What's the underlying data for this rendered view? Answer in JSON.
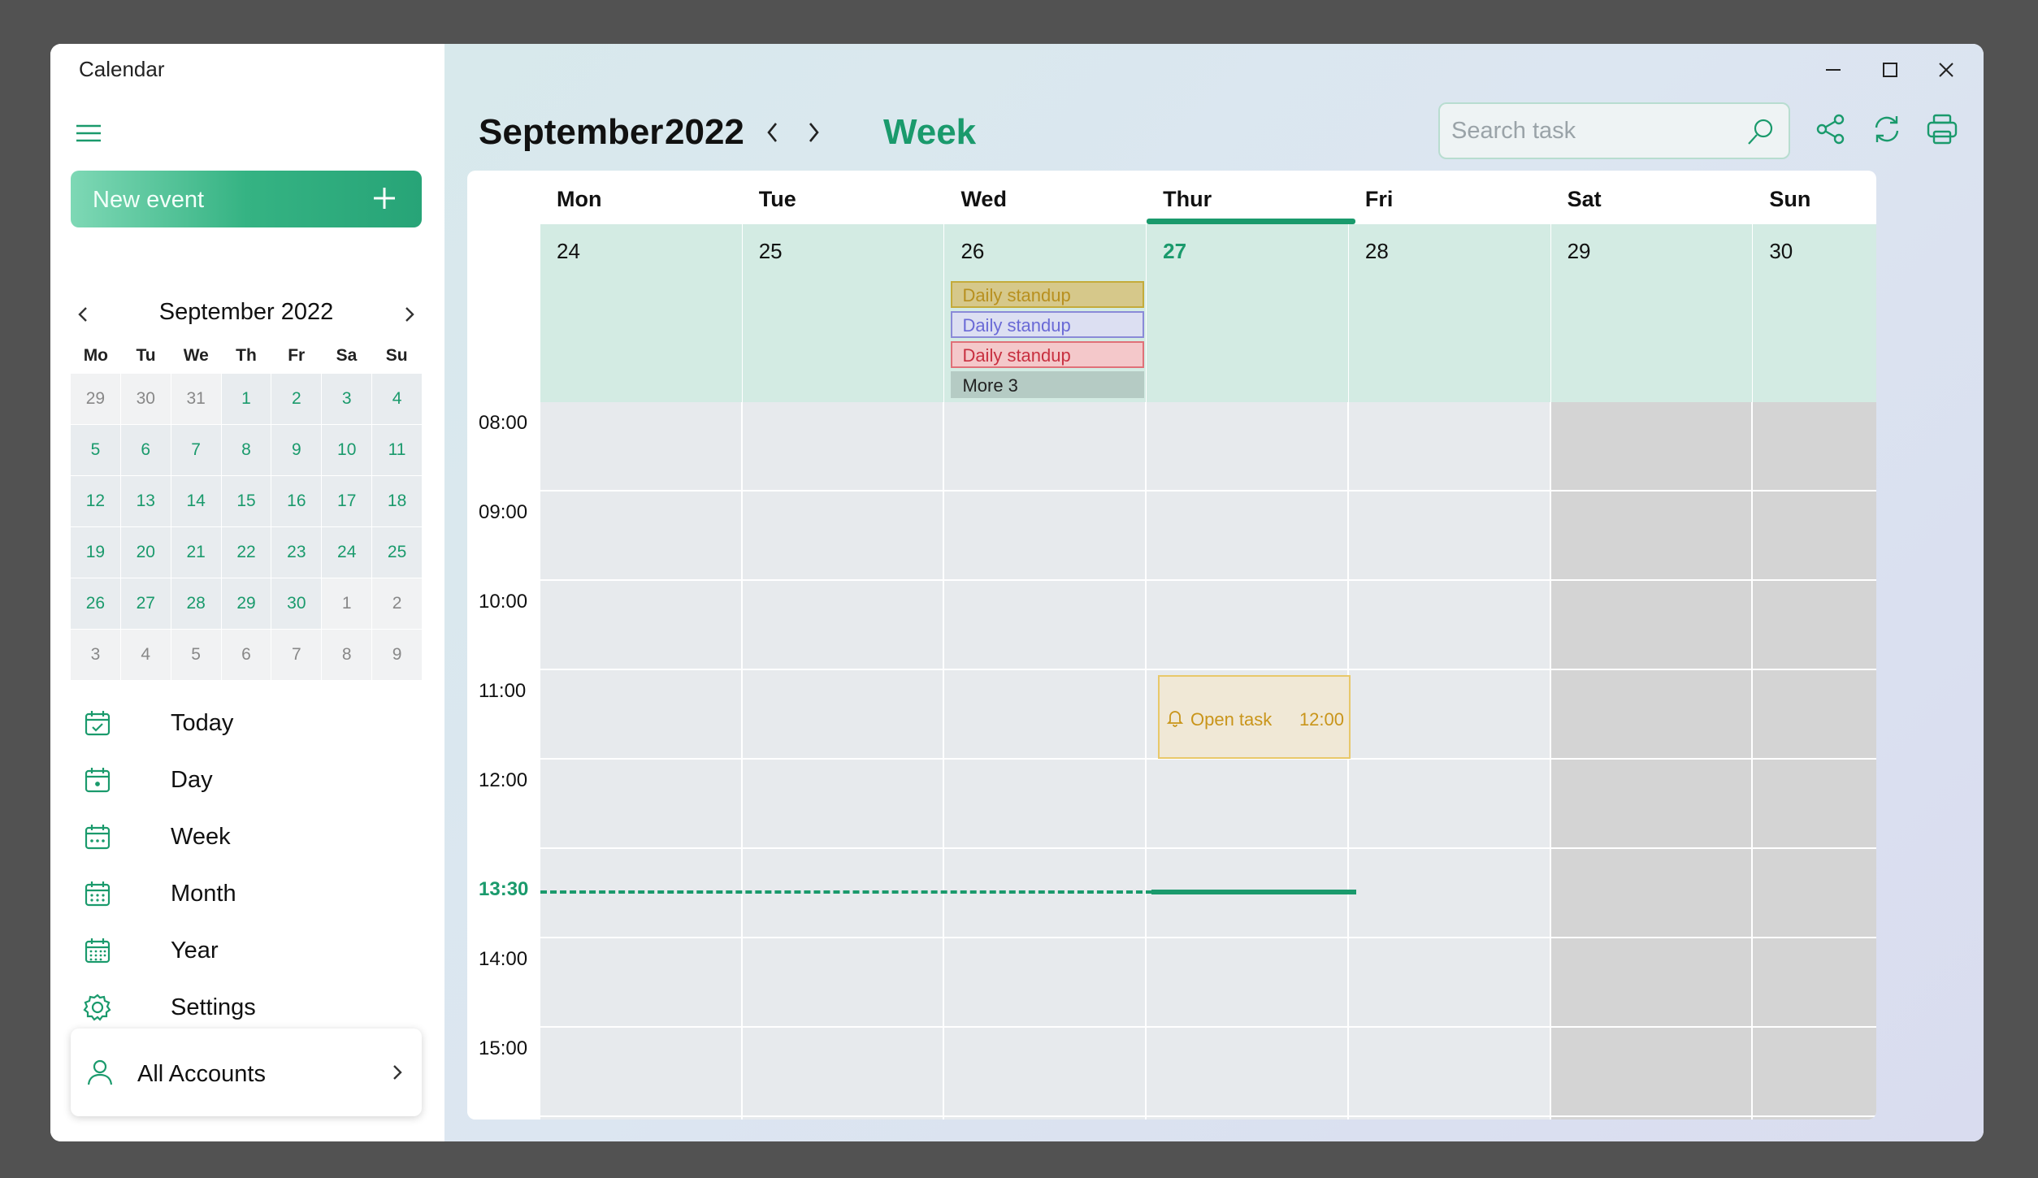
{
  "app": {
    "title": "Calendar"
  },
  "sidebar": {
    "new_event_label": "New event",
    "mini_calendar": {
      "title": "September 2022",
      "weekdays": [
        "Mo",
        "Tu",
        "We",
        "Th",
        "Fr",
        "Sa",
        "Su"
      ],
      "weeks": [
        [
          "29",
          "30",
          "31",
          "1",
          "2",
          "3",
          "4"
        ],
        [
          "5",
          "6",
          "7",
          "8",
          "9",
          "10",
          "11"
        ],
        [
          "12",
          "13",
          "14",
          "15",
          "16",
          "17",
          "18"
        ],
        [
          "19",
          "20",
          "21",
          "22",
          "23",
          "24",
          "25"
        ],
        [
          "26",
          "27",
          "28",
          "29",
          "30",
          "1",
          "2"
        ],
        [
          "3",
          "4",
          "5",
          "6",
          "7",
          "8",
          "9"
        ]
      ]
    },
    "nav": [
      {
        "label": "Today",
        "icon": "calendar-check-icon"
      },
      {
        "label": "Day",
        "icon": "calendar-day-icon"
      },
      {
        "label": "Week",
        "icon": "calendar-week-icon"
      },
      {
        "label": "Month",
        "icon": "calendar-month-icon"
      },
      {
        "label": "Year",
        "icon": "calendar-year-icon"
      },
      {
        "label": "Settings",
        "icon": "gear-icon"
      }
    ],
    "accounts_label": "All Accounts"
  },
  "header": {
    "month": "September",
    "year": "2022",
    "view": "Week",
    "search_placeholder": "Search task"
  },
  "week": {
    "days": [
      {
        "name": "Mon",
        "date": "24"
      },
      {
        "name": "Tue",
        "date": "25"
      },
      {
        "name": "Wed",
        "date": "26"
      },
      {
        "name": "Thur",
        "date": "27",
        "today": true
      },
      {
        "name": "Fri",
        "date": "28"
      },
      {
        "name": "Sat",
        "date": "29"
      },
      {
        "name": "Sun",
        "date": "30"
      }
    ],
    "allday_events": [
      {
        "label": "Daily standup",
        "color": "#c4ab3a"
      },
      {
        "label": "Daily standup",
        "color": "#8a8ad8"
      },
      {
        "label": "Daily standup",
        "color": "#e07078"
      }
    ],
    "more_label": "More 3",
    "times": [
      "08:00",
      "09:00",
      "10:00",
      "11:00",
      "12:00",
      "13:30",
      "14:00",
      "15:00"
    ],
    "now_time": "13:30",
    "task": {
      "title": "Open task",
      "time": "12:00"
    }
  },
  "colors": {
    "accent": "#1a9a6c",
    "weekend": "#d4d4d4",
    "allday_bg": "#d3ebe3"
  }
}
